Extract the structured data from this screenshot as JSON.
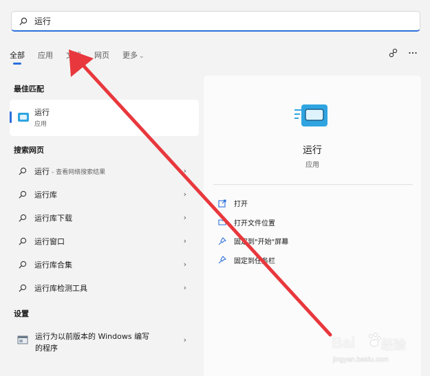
{
  "search": {
    "value": "运行",
    "icon": "search-icon"
  },
  "tabs": [
    {
      "label": "全部",
      "active": true
    },
    {
      "label": "应用"
    },
    {
      "label": "文档"
    },
    {
      "label": "网页"
    },
    {
      "label": "更多"
    }
  ],
  "top_icons": [
    "share-icon",
    "more-icon"
  ],
  "best_match": {
    "heading": "最佳匹配",
    "name": "运行",
    "type": "应用",
    "icon": "run-app-icon"
  },
  "web_search": {
    "heading": "搜索网页",
    "items": [
      {
        "text": "运行",
        "hint": "- 查看网络搜索结果"
      },
      {
        "text": "运行库"
      },
      {
        "text": "运行库下载"
      },
      {
        "text": "运行窗口"
      },
      {
        "text": "运行库合集"
      },
      {
        "text": "运行库检测工具"
      }
    ]
  },
  "settings": {
    "heading": "设置",
    "item_line1": "运行为以前版本的 Windows 编写",
    "item_line2": "的程序"
  },
  "details": {
    "name": "运行",
    "type": "应用",
    "actions": [
      {
        "label": "打开",
        "icon": "open-icon"
      },
      {
        "label": "打开文件位置",
        "icon": "folder-icon"
      },
      {
        "label": "固定到\"开始\"屏幕",
        "icon": "pin-icon"
      },
      {
        "label": "固定到任务栏",
        "icon": "pin-icon"
      }
    ]
  },
  "watermark": {
    "brand": "Bai",
    "brand2": "经验",
    "url": "jingyan.baidu.com"
  },
  "colors": {
    "accent": "#2a6fdb",
    "arrow": "#e8383d",
    "background": "#f3f3f3",
    "panel": "#fbfbfb"
  }
}
